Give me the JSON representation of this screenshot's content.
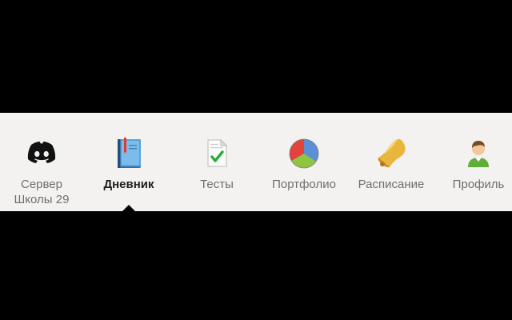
{
  "tabs": [
    {
      "id": "server",
      "label_line1": "Сервер",
      "label_line2": "Школы 29",
      "icon": "discord-icon"
    },
    {
      "id": "diary",
      "label": "Дневник",
      "icon": "book-icon",
      "active": true
    },
    {
      "id": "tests",
      "label": "Тесты",
      "icon": "checklist-icon"
    },
    {
      "id": "portfolio",
      "label": "Портфолио",
      "icon": "pie-chart-icon"
    },
    {
      "id": "schedule",
      "label": "Расписание",
      "icon": "bell-icon"
    },
    {
      "id": "profile",
      "label": "Профиль",
      "icon": "user-icon"
    }
  ],
  "colors": {
    "toolbar_bg": "#f3f2f1",
    "label_inactive": "#6f6f6f",
    "label_active": "#1e1e1e"
  }
}
